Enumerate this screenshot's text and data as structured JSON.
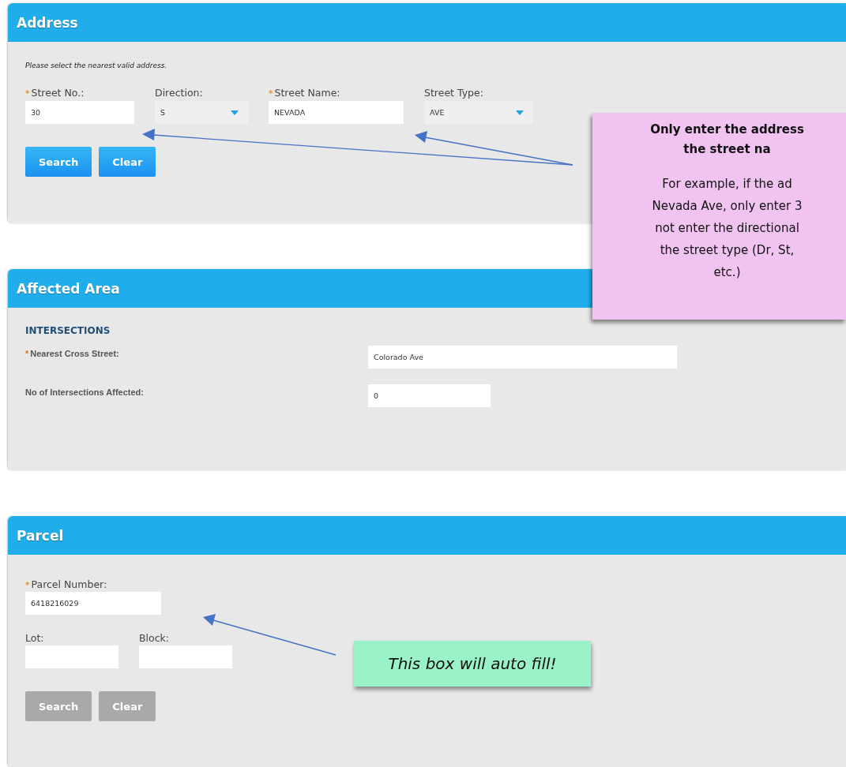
{
  "sections": [
    {
      "kind": "address",
      "title": "Address",
      "note": "Please select the nearest valid address.",
      "fields": [
        {
          "kind": "text",
          "label": "Street No.:",
          "required_mark": "*",
          "value": "30"
        },
        {
          "kind": "select",
          "label": "Direction:",
          "value": "S"
        },
        {
          "kind": "text",
          "label": "Street Name:",
          "required_mark": "*",
          "value": "NEVADA"
        },
        {
          "kind": "select",
          "label": "Street Type:",
          "value": "AVE"
        }
      ],
      "buttons": [
        {
          "label": "Search",
          "disabled": false
        },
        {
          "label": "Clear",
          "disabled": false
        }
      ]
    },
    {
      "kind": "affected",
      "title": "Affected Area",
      "heading": "INTERSECTIONS",
      "fields": [
        {
          "kind": "wide",
          "label": "Nearest Cross Street:",
          "required_mark": "*",
          "value": "Colorado Ave"
        },
        {
          "kind": "short",
          "label": "No of Intersections Affected:",
          "value": "0"
        }
      ]
    },
    {
      "kind": "parcel",
      "title": "Parcel",
      "fields": [
        {
          "label": "Parcel Number:",
          "required_mark": "*",
          "value": "6418216029"
        },
        {
          "label": "Lot:"
        },
        {
          "label": "Block:"
        }
      ],
      "buttons": [
        {
          "label": "Search",
          "disabled": true
        },
        {
          "label": "Clear",
          "disabled": true
        }
      ]
    }
  ],
  "callouts": [
    {
      "kind": "pink",
      "title_lines": [
        "Only enter the address",
        "the street na"
      ],
      "body_lines": [
        "For example, if the ad",
        "Nevada Ave, only enter 3",
        "not enter the directional",
        "the street type (Dr, St,",
        "etc.)"
      ]
    },
    {
      "kind": "green",
      "text": "This box will auto fill!"
    }
  ]
}
